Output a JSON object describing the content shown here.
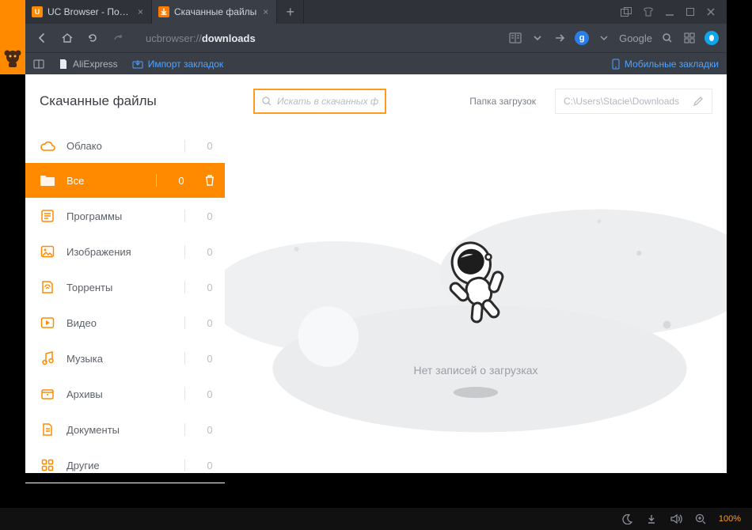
{
  "tabs": [
    {
      "label": "UC Browser - Погода,",
      "icon_color": "#ff8a00"
    },
    {
      "label": "Скачанные файлы",
      "icon_color": "#ff7a00"
    }
  ],
  "url": {
    "scheme": "ucbrowser://",
    "path": "downloads"
  },
  "search_engine": {
    "badge": "g",
    "name": "Google"
  },
  "bookmarks_bar": {
    "aliexpress": "AliExpress",
    "import": "Импорт закладок",
    "mobile": "Мобильные закладки"
  },
  "downloads": {
    "title": "Скачанные файлы",
    "search_placeholder": "Искать в скачанных файлах",
    "folder_label": "Папка загрузок",
    "folder_path": "C:\\Users\\Stacie\\Downloads",
    "empty_message": "Нет записей о загрузках"
  },
  "categories": {
    "cloud": {
      "label": "Облако",
      "count": "0"
    },
    "all": {
      "label": "Все",
      "count": "0"
    },
    "apps": {
      "label": "Программы",
      "count": "0"
    },
    "images": {
      "label": "Изображения",
      "count": "0"
    },
    "torrents": {
      "label": "Торренты",
      "count": "0"
    },
    "video": {
      "label": "Видео",
      "count": "0"
    },
    "music": {
      "label": "Музыка",
      "count": "0"
    },
    "archives": {
      "label": "Архивы",
      "count": "0"
    },
    "docs": {
      "label": "Документы",
      "count": "0"
    },
    "other": {
      "label": "Другие",
      "count": "0"
    }
  },
  "status": {
    "zoom": "100%"
  }
}
